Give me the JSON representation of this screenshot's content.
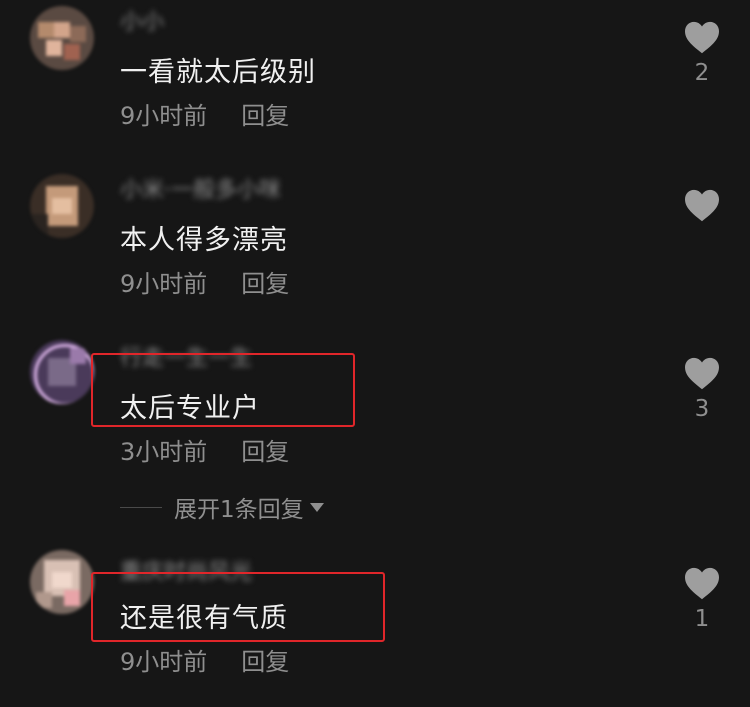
{
  "comments": [
    {
      "username": "小小",
      "text": "一看就太后级别",
      "time": "9小时前",
      "reply": "回复",
      "likes": "2"
    },
    {
      "username": "小米·一般多小咪",
      "text": "本人得多漂亮",
      "time": "9小时前",
      "reply": "回复",
      "likes": ""
    },
    {
      "username": "行走一生一生",
      "text": "太后专业户",
      "time": "3小时前",
      "reply": "回复",
      "likes": "3"
    },
    {
      "username": "重庆时尚风光",
      "text": "还是很有气质",
      "time": "9小时前",
      "reply": "回复",
      "likes": "1"
    }
  ],
  "expand_replies": "展开1条回复",
  "icons": {
    "like": "heart-icon",
    "expand": "triangle-down-icon"
  },
  "colors": {
    "background": "#161616",
    "highlight": "#e0262a",
    "text": "#f0f0f0",
    "muted": "#8f8f8f",
    "heart": "#9e9e9e"
  }
}
